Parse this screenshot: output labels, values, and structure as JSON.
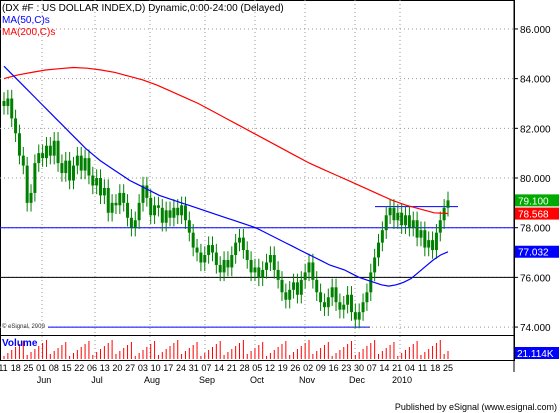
{
  "header": {
    "title": "(DX #F : US DOLLAR INDEX,D) Dynamic,0:00-24:00 (Delayed)",
    "ma50_label": "MA(50,C)s",
    "ma200_label": "MA(200,C)s",
    "copyright": "© eSignal, 2009"
  },
  "volume_panel": {
    "label": "Volume",
    "value_badge": "21.114K"
  },
  "footer": {
    "published": "Published by eSignal (www.esignal.com)"
  },
  "colors": {
    "candle": "#008000",
    "ma50": "#0000ff",
    "ma200": "#ff0000",
    "price_badge": "#00aa00",
    "ma200_badge": "#ff0000",
    "ma50_badge": "#0000ff",
    "volume_bar": "#ff0000",
    "volume_badge": "#0000ff"
  },
  "chart_data": {
    "type": "candlestick",
    "title": "(DX #F : US DOLLAR INDEX,D) Dynamic,0:00-24:00 (Delayed)",
    "ylim": [
      73.6,
      86.5
    ],
    "y_ticks": [
      "74.000",
      "76.000",
      "78.000",
      "80.000",
      "82.000",
      "84.000",
      "86.000"
    ],
    "x_day_labels": [
      "11",
      "18",
      "25",
      "01",
      "08",
      "15",
      "22",
      "06",
      "13",
      "20",
      "27",
      "03",
      "10",
      "17",
      "24",
      "31",
      "07",
      "14",
      "21",
      "28",
      "05",
      "12",
      "19",
      "26",
      "02",
      "09",
      "16",
      "23",
      "30",
      "07",
      "14",
      "21",
      "04",
      "11",
      "18",
      "25"
    ],
    "x_month_labels": [
      "Jun",
      "Jul",
      "Aug",
      "Sep",
      "Oct",
      "Nov",
      "Dec",
      "2010"
    ],
    "price_badges": {
      "last": "79.100",
      "ma200": "78.568",
      "ma50": "77.032"
    },
    "horizontal_lines": [
      {
        "name": "support-78",
        "value": 78.0
      },
      {
        "name": "support-76",
        "value": 76.0
      },
      {
        "name": "low-line",
        "value": 74.0
      },
      {
        "name": "breakout-line",
        "value": 78.85
      }
    ],
    "closes": [
      82.9,
      83.2,
      82.4,
      81.8,
      80.9,
      80.5,
      79.0,
      79.4,
      80.6,
      81.0,
      80.8,
      81.3,
      80.9,
      81.5,
      80.6,
      80.2,
      80.7,
      79.9,
      80.5,
      80.9,
      80.3,
      80.8,
      80.1,
      79.7,
      80.0,
      79.3,
      79.6,
      78.6,
      79.0,
      78.9,
      79.4,
      79.0,
      78.4,
      78.0,
      78.3,
      79.0,
      79.7,
      79.2,
      78.5,
      78.9,
      78.8,
      78.2,
      78.7,
      78.4,
      78.8,
      78.5,
      78.9,
      78.3,
      77.8,
      77.2,
      77.0,
      76.6,
      76.9,
      77.3,
      77.0,
      76.5,
      76.2,
      76.7,
      76.4,
      76.9,
      77.4,
      77.6,
      77.1,
      76.7,
      76.2,
      76.4,
      76.0,
      76.3,
      76.6,
      76.9,
      76.3,
      75.9,
      75.4,
      75.1,
      75.5,
      75.8,
      75.3,
      75.9,
      76.2,
      76.6,
      75.9,
      75.4,
      75.0,
      74.8,
      75.2,
      75.6,
      75.0,
      74.7,
      74.9,
      75.3,
      74.6,
      74.3,
      74.6,
      75.0,
      75.4,
      76.2,
      76.8,
      77.4,
      77.9,
      78.5,
      78.8,
      78.3,
      78.6,
      78.1,
      78.5,
      78.0,
      78.3,
      77.6,
      77.9,
      77.2,
      77.5,
      77.1,
      77.8,
      78.3,
      78.8,
      79.1
    ],
    "ma50": [
      84.5,
      84.2,
      83.9,
      83.6,
      83.3,
      83.0,
      82.7,
      82.4,
      82.1,
      81.8,
      81.5,
      81.2,
      80.95,
      80.7,
      80.5,
      80.3,
      80.1,
      79.9,
      79.75,
      79.6,
      79.45,
      79.3,
      79.2,
      79.1,
      79.0,
      78.9,
      78.8,
      78.7,
      78.6,
      78.5,
      78.4,
      78.3,
      78.2,
      78.1,
      78.0,
      77.85,
      77.7,
      77.55,
      77.4,
      77.25,
      77.1,
      76.95,
      76.8,
      76.65,
      76.5,
      76.4,
      76.3,
      76.15,
      76.0,
      75.9,
      75.8,
      75.7,
      75.65,
      75.7,
      75.8,
      75.95,
      76.2,
      76.45,
      76.7,
      76.9,
      77.03
    ],
    "ma200": [
      84.0,
      84.15,
      84.25,
      84.35,
      84.4,
      84.45,
      84.42,
      84.35,
      84.25,
      84.1,
      83.95,
      83.75,
      83.5,
      83.25,
      83.0,
      82.7,
      82.4,
      82.1,
      81.8,
      81.5,
      81.2,
      80.9,
      80.6,
      80.35,
      80.1,
      79.85,
      79.6,
      79.35,
      79.1,
      78.9,
      78.75,
      78.6,
      78.57
    ]
  }
}
